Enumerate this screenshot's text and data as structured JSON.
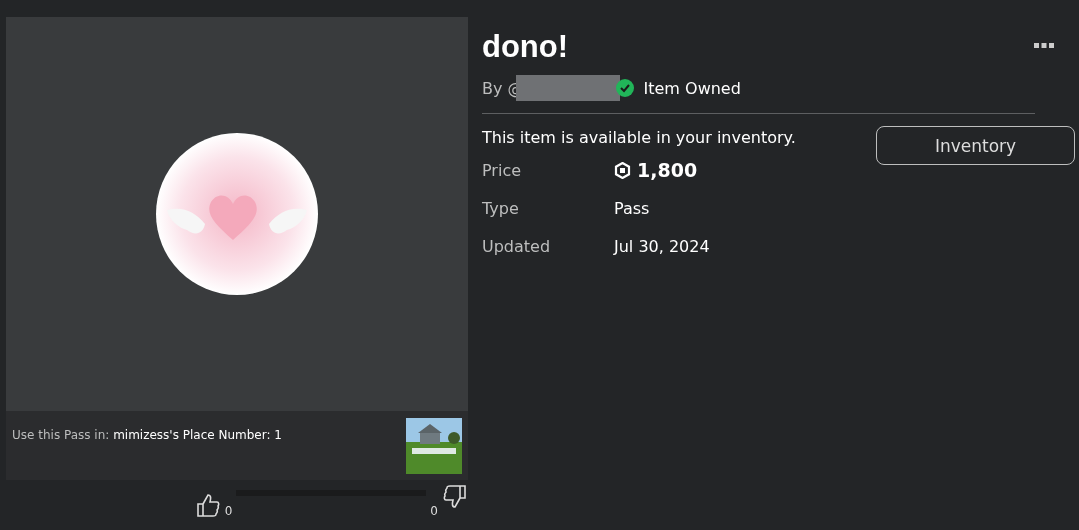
{
  "place": {
    "label": "Use this Pass in:",
    "name": "mimizess's Place Number: 1"
  },
  "votes": {
    "up": "0",
    "down": "0"
  },
  "title": "dono!",
  "creator": {
    "prefix": "By @",
    "owned": "Item Owned"
  },
  "notice": "This item is available in your inventory.",
  "button": "Inventory",
  "details": [
    {
      "label": "Price",
      "value": "1,800",
      "kind": "price"
    },
    {
      "label": "Type",
      "value": "Pass",
      "kind": "text"
    },
    {
      "label": "Updated",
      "value": "Jul 30, 2024",
      "kind": "text"
    }
  ]
}
